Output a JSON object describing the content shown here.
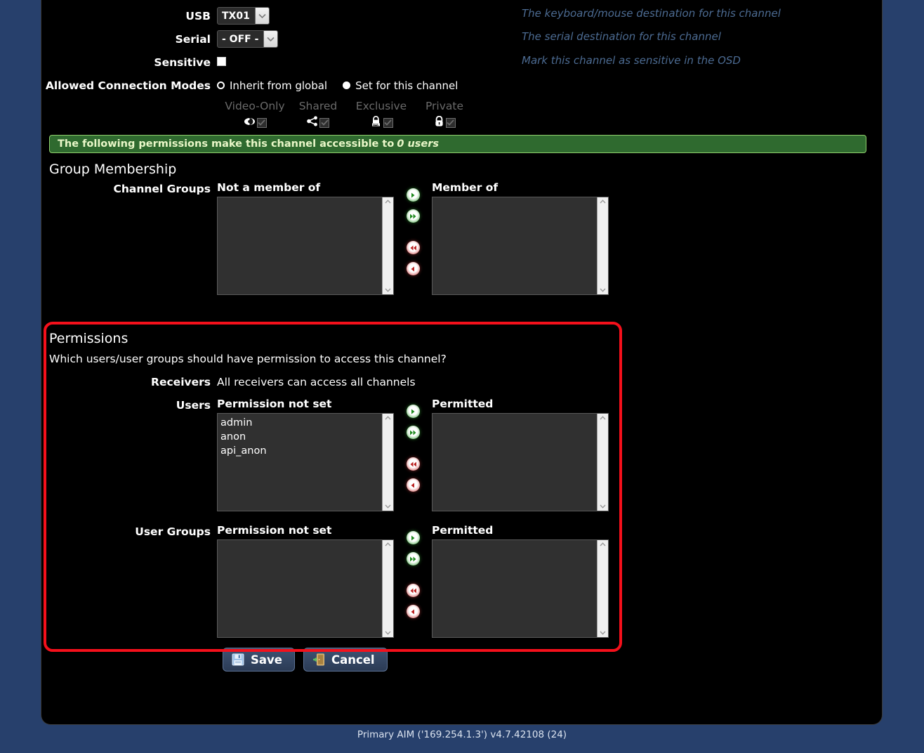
{
  "form": {
    "rows": [
      {
        "label": "USB",
        "value": "TX01",
        "help": "The keyboard/mouse destination for this channel"
      },
      {
        "label": "Serial",
        "value": "- OFF -",
        "help": "The serial destination for this channel"
      }
    ],
    "sensitive": {
      "label": "Sensitive",
      "help": "Mark this channel as sensitive in the OSD",
      "checked": true
    },
    "connection_modes": {
      "label": "Allowed Connection Modes",
      "options": [
        {
          "label": "Inherit from global",
          "selected": false
        },
        {
          "label": "Set for this channel",
          "selected": true
        }
      ],
      "modes": [
        {
          "label": "Video-Only",
          "icon": "eye-icon",
          "checked": false
        },
        {
          "label": "Shared",
          "icon": "share-icon",
          "checked": false
        },
        {
          "label": "Exclusive",
          "icon": "lock-keyboard-icon",
          "checked": false
        },
        {
          "label": "Private",
          "icon": "lock-icon",
          "checked": false
        }
      ]
    }
  },
  "banner": {
    "text": "The following permissions make this channel accessible to",
    "emphasis": "0 users"
  },
  "group_membership": {
    "heading": "Group Membership",
    "row_label": "Channel Groups",
    "left_caption": "Not a member of",
    "right_caption": "Member of",
    "left_items": [],
    "right_items": []
  },
  "permissions": {
    "heading": "Permissions",
    "question": "Which users/user groups should have permission to access this channel?",
    "receivers_label": "Receivers",
    "receivers_value": "All receivers can access all channels",
    "users": {
      "row_label": "Users",
      "left_caption": "Permission not set",
      "right_caption": "Permitted",
      "left_items": [
        "admin",
        "anon",
        "api_anon"
      ],
      "right_items": []
    },
    "user_groups": {
      "row_label": "User Groups",
      "left_caption": "Permission not set",
      "right_caption": "Permitted",
      "left_items": [],
      "right_items": []
    },
    "highlight_color": "#f5101b"
  },
  "transfer_buttons": [
    {
      "name": "move-right-icon",
      "dir": "right",
      "color": "green"
    },
    {
      "name": "move-all-right-icon",
      "dir": "right-all",
      "color": "green"
    },
    {
      "name": "move-all-left-icon",
      "dir": "left-all",
      "color": "red"
    },
    {
      "name": "move-left-icon",
      "dir": "left",
      "color": "red"
    }
  ],
  "actions": {
    "save": "Save",
    "cancel": "Cancel"
  },
  "footer": {
    "text": "Primary AIM ('169.254.1.3') v4.7.42108 (24)"
  }
}
